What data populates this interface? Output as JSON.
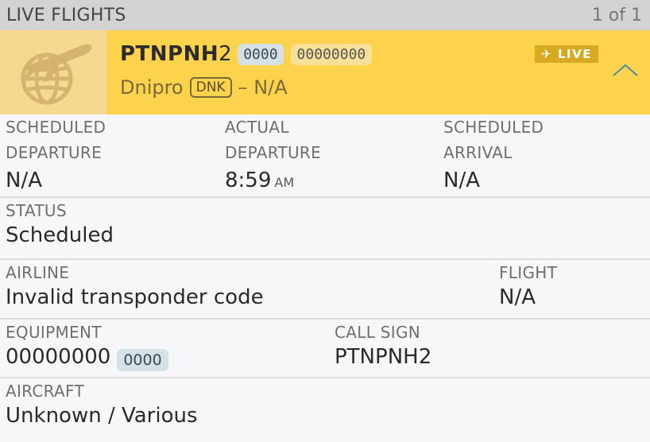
{
  "topbar": {
    "title": "LIVE FLIGHTS",
    "pager": "1 of 1"
  },
  "header": {
    "callsign_bold": "PTNPNH",
    "callsign_light": "2",
    "squawk": "0000",
    "hex": "00000000",
    "origin_city": "Dnipro",
    "origin_code": "DNK",
    "destination": "– N/A",
    "live_label": "LIVE",
    "plane_icon": "plane-icon",
    "collapse_icon": "chevron-up-icon",
    "accent": "#fdd24c"
  },
  "times": {
    "sched_dep_label_1": "SCHEDULED",
    "sched_dep_label_2": "DEPARTURE",
    "sched_dep_value": "N/A",
    "actual_dep_label_1": "ACTUAL",
    "actual_dep_label_2": "DEPARTURE",
    "actual_dep_value": "8:59",
    "actual_dep_ampm": "AM",
    "sched_arr_label_1": "SCHEDULED",
    "sched_arr_label_2": "ARRIVAL",
    "sched_arr_value": "N/A"
  },
  "status": {
    "label": "STATUS",
    "value": "Scheduled"
  },
  "airline": {
    "label": "AIRLINE",
    "value": "Invalid transponder code",
    "flight_label": "FLIGHT",
    "flight_value": "N/A"
  },
  "equipment": {
    "label": "EQUIPMENT",
    "value": "00000000",
    "badge": "0000",
    "callsign_label": "CALL SIGN",
    "callsign_value": "PTNPNH2"
  },
  "aircraft": {
    "label": "AIRCRAFT",
    "value": "Unknown / Various"
  }
}
